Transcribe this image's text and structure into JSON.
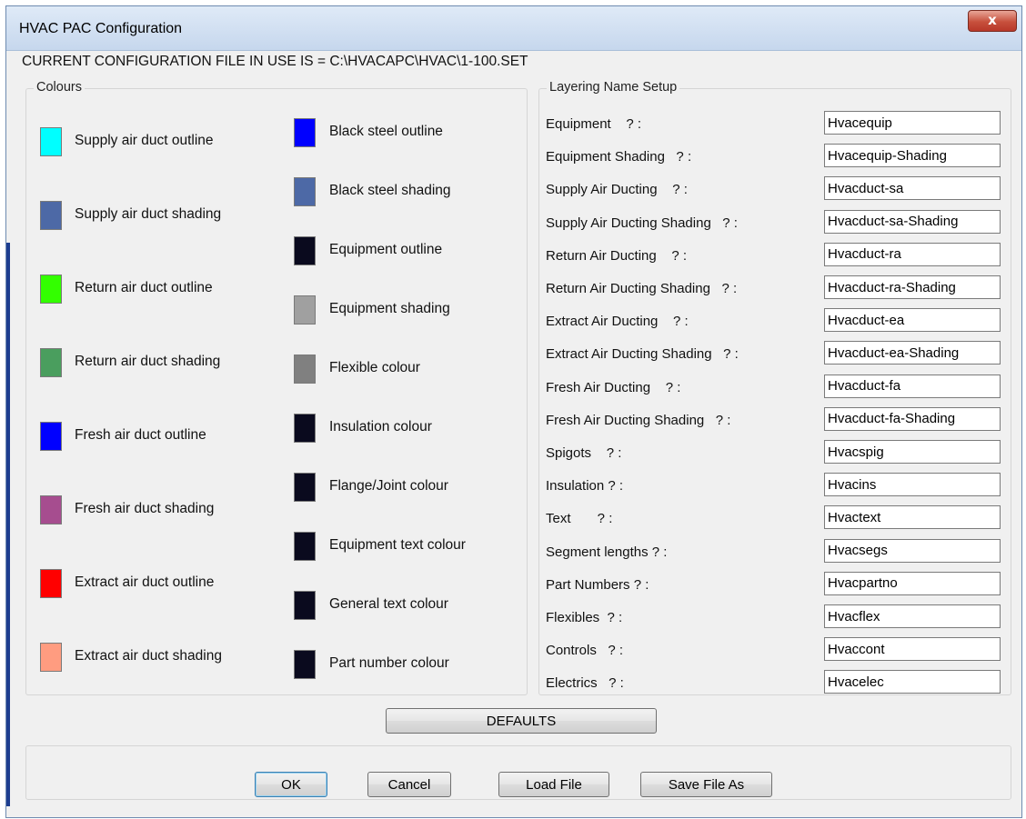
{
  "window": {
    "title": "HVAC PAC Configuration",
    "close_glyph": "x"
  },
  "current_file": "CURRENT  CONFIGURATION  FILE  IN  USE  IS = C:\\HVACAPC\\HVAC\\1-100.SET",
  "colours": {
    "label": "Colours",
    "items": [
      {
        "label": "Supply air duct outline",
        "color": "#00ffff"
      },
      {
        "label": "Supply air duct shading",
        "color": "#4d69a6"
      },
      {
        "label": "Return air duct outline",
        "color": "#33ff00"
      },
      {
        "label": "Return air duct shading",
        "color": "#4a9e5e"
      },
      {
        "label": "Fresh air duct outline",
        "color": "#0000ff"
      },
      {
        "label": "Fresh air duct shading",
        "color": "#a64d8f"
      },
      {
        "label": "Extract air duct outline",
        "color": "#ff0000"
      },
      {
        "label": "Extract air duct shading",
        "color": "#ff9c80"
      },
      {
        "label": "Black steel outline",
        "color": "#0000ff"
      },
      {
        "label": "Black steel shading",
        "color": "#4d69a6"
      },
      {
        "label": "Equipment outline",
        "color": "#0a0a1e"
      },
      {
        "label": "Equipment shading",
        "color": "#a0a0a0"
      },
      {
        "label": "Flexible colour",
        "color": "#808080"
      },
      {
        "label": "Insulation colour",
        "color": "#0a0a1e"
      },
      {
        "label": "Flange/Joint colour",
        "color": "#0a0a1e"
      },
      {
        "label": "Equipment text colour",
        "color": "#0a0a1e"
      },
      {
        "label": "General text colour",
        "color": "#0a0a1e"
      },
      {
        "label": "Part number colour",
        "color": "#0a0a1e"
      }
    ]
  },
  "layering": {
    "label": "Layering Name Setup",
    "items": [
      {
        "label": "Equipment    ? :",
        "value": "Hvacequip"
      },
      {
        "label": "Equipment Shading   ? :",
        "value": "Hvacequip-Shading"
      },
      {
        "label": "Supply Air Ducting    ? :",
        "value": "Hvacduct-sa"
      },
      {
        "label": "Supply Air Ducting Shading   ? :",
        "value": "Hvacduct-sa-Shading"
      },
      {
        "label": "Return Air Ducting    ? :",
        "value": "Hvacduct-ra"
      },
      {
        "label": "Return Air Ducting Shading   ? :",
        "value": "Hvacduct-ra-Shading"
      },
      {
        "label": "Extract Air Ducting    ? :",
        "value": "Hvacduct-ea"
      },
      {
        "label": "Extract Air Ducting Shading   ? :",
        "value": "Hvacduct-ea-Shading"
      },
      {
        "label": "Fresh Air Ducting    ? :",
        "value": "Hvacduct-fa"
      },
      {
        "label": "Fresh Air Ducting Shading   ? :",
        "value": "Hvacduct-fa-Shading"
      },
      {
        "label": "Spigots    ? :",
        "value": "Hvacspig"
      },
      {
        "label": "Insulation ? :",
        "value": "Hvacins"
      },
      {
        "label": "Text       ? :",
        "value": "Hvactext"
      },
      {
        "label": "Segment lengths ? :",
        "value": "Hvacsegs"
      },
      {
        "label": "Part Numbers ? :",
        "value": "Hvacpartno"
      },
      {
        "label": "Flexibles  ? :",
        "value": "Hvacflex"
      },
      {
        "label": "Controls   ? :",
        "value": "Hvaccont"
      },
      {
        "label": "Electrics   ? :",
        "value": "Hvacelec"
      }
    ]
  },
  "buttons": {
    "defaults": "DEFAULTS",
    "ok": "OK",
    "cancel": "Cancel",
    "load": "Load  File",
    "save": "Save File As"
  }
}
